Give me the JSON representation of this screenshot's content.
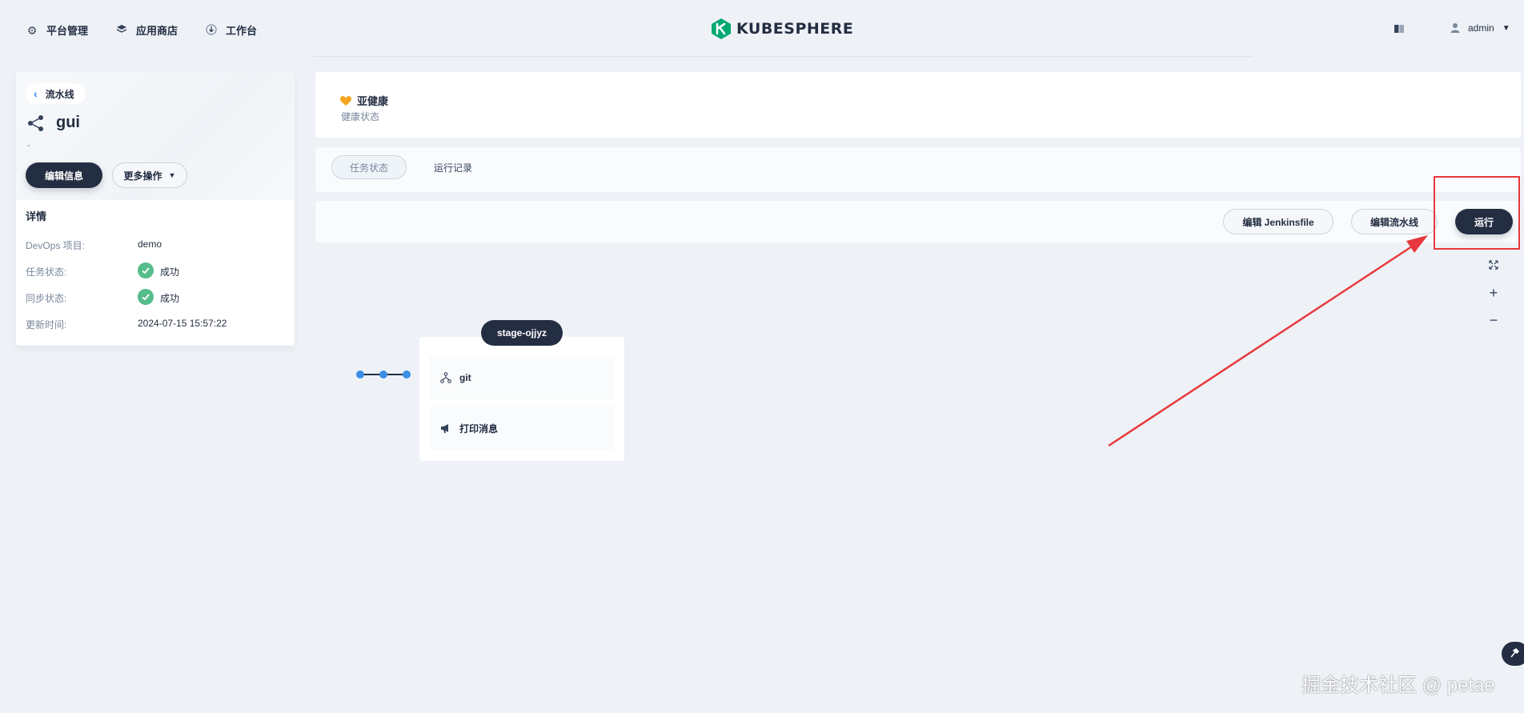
{
  "topnav": {
    "items": [
      {
        "label": "平台管理",
        "icon": "gear-icon"
      },
      {
        "label": "应用商店",
        "icon": "layers-icon"
      },
      {
        "label": "工作台",
        "icon": "download-icon"
      }
    ],
    "brand": "KUBESPHERE",
    "user": "admin"
  },
  "sidebar": {
    "back_label": "流水线",
    "pipeline_name": "gui",
    "description": "-",
    "edit_info_label": "编辑信息",
    "more_actions_label": "更多操作",
    "details_title": "详情",
    "details": [
      {
        "key": "DevOps 项目:",
        "value": "demo"
      },
      {
        "key": "任务状态:",
        "value": "成功"
      },
      {
        "key": "同步状态:",
        "value": "成功"
      },
      {
        "key": "更新时间:",
        "value": "2024-07-15 15:57:22"
      }
    ]
  },
  "health": {
    "title": "亚健康",
    "subtitle": "健康状态"
  },
  "tabs": [
    {
      "label": "任务状态",
      "active": true
    },
    {
      "label": "运行记录",
      "active": false
    }
  ],
  "toolbar": {
    "edit_jenkinsfile_label": "编辑 Jenkinsfile",
    "edit_pipeline_label": "编辑流水线",
    "run_label": "运行"
  },
  "graph": {
    "stage_name": "stage-ojjyz",
    "steps": [
      {
        "label": "git",
        "icon": "git-branch-icon"
      },
      {
        "label": "打印消息",
        "icon": "megaphone-icon"
      }
    ]
  },
  "zoom_controls": [
    "fullscreen-icon",
    "zoom-in-icon",
    "zoom-out-icon"
  ],
  "watermark": "掘金技术社区 @ petae",
  "colors": {
    "dark": "#242e42",
    "accent": "#3385ff",
    "success": "#55bc8a",
    "annotation_red": "#e8383d",
    "health_orange": "#f5a623",
    "brand_green": "#00a971"
  }
}
